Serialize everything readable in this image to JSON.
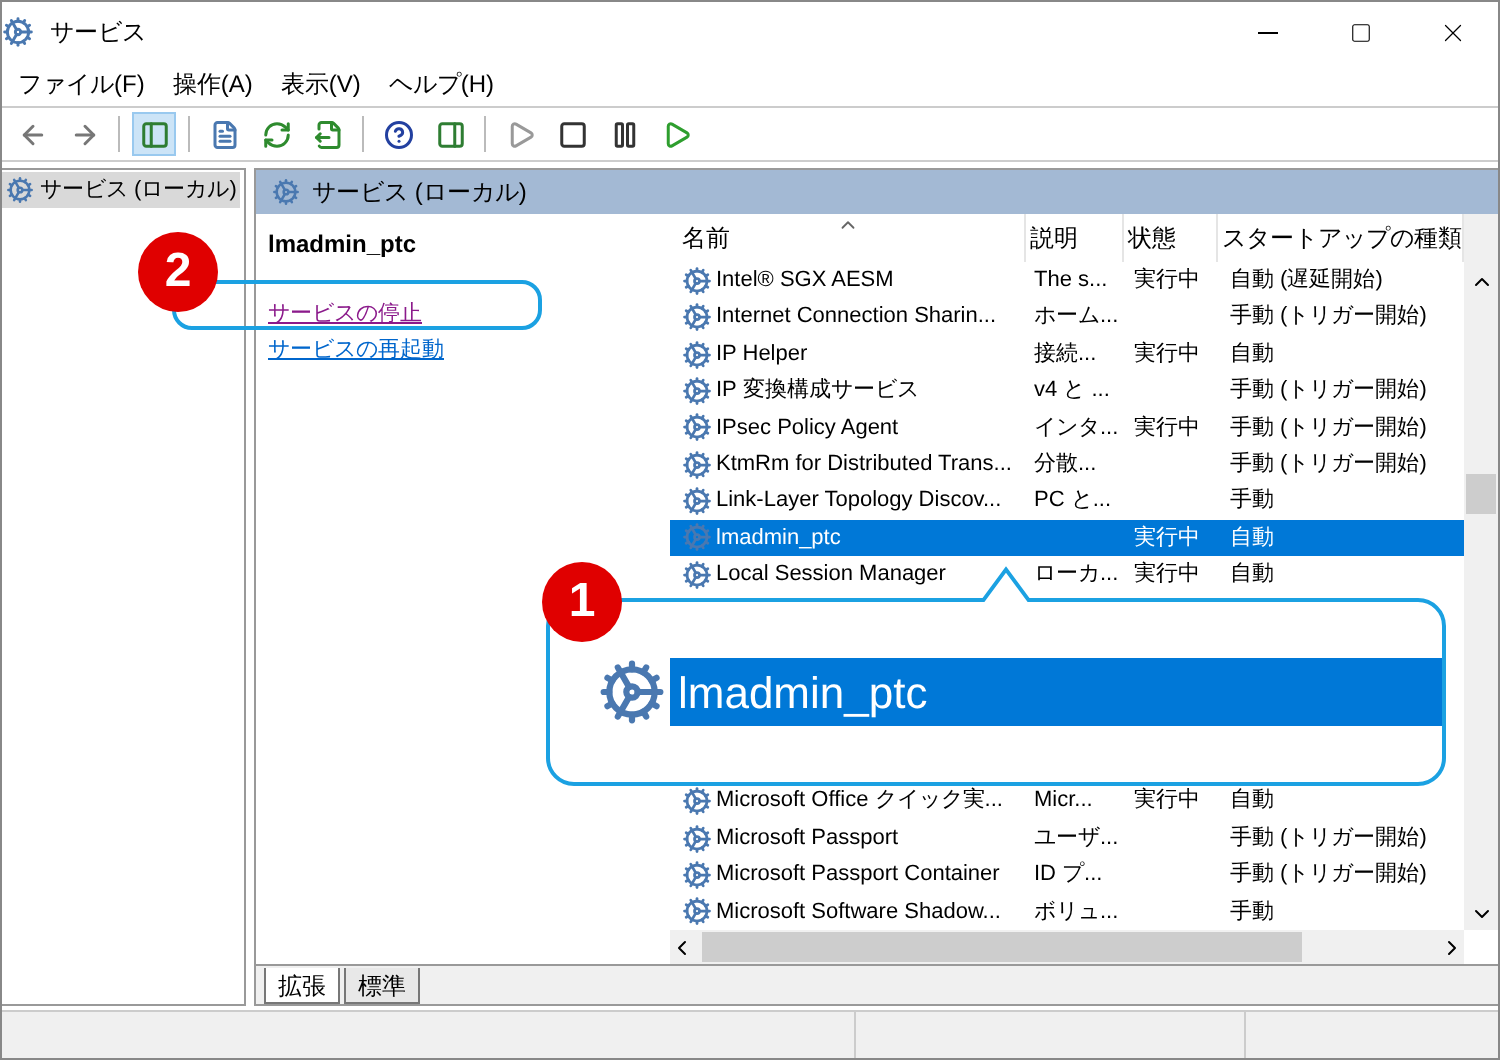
{
  "window": {
    "title": "サービス"
  },
  "menu": [
    {
      "label": "ファイル(F)"
    },
    {
      "label": "操作(A)"
    },
    {
      "label": "表示(V)"
    },
    {
      "label": "ヘルプ(H)"
    }
  ],
  "toolbar": [
    {
      "kind": "back",
      "pressed": false
    },
    {
      "kind": "forward",
      "pressed": false
    },
    {
      "kind": "sep"
    },
    {
      "kind": "tree",
      "pressed": true
    },
    {
      "kind": "sep"
    },
    {
      "kind": "props",
      "pressed": false
    },
    {
      "kind": "refresh",
      "pressed": false
    },
    {
      "kind": "export",
      "pressed": false
    },
    {
      "kind": "sep"
    },
    {
      "kind": "help",
      "pressed": false
    },
    {
      "kind": "panel",
      "pressed": false
    },
    {
      "kind": "sep"
    },
    {
      "kind": "start",
      "pressed": false
    },
    {
      "kind": "stop",
      "pressed": false
    },
    {
      "kind": "pause",
      "pressed": false
    },
    {
      "kind": "resume",
      "pressed": false
    }
  ],
  "tree": [
    {
      "label": "サービス (ローカル)",
      "selected": true
    }
  ],
  "pane": {
    "header": "サービス (ローカル)",
    "service_name": "lmadmin_ptc",
    "actions": [
      {
        "label": "サービスの停止",
        "visited": true
      },
      {
        "label": "サービスの再起動",
        "visited": false
      }
    ]
  },
  "table": {
    "columns": [
      {
        "label": "名前",
        "sorted": true
      },
      {
        "label": "説明",
        "sorted": false
      },
      {
        "label": "状態",
        "sorted": false
      },
      {
        "label": "スタートアップの種類",
        "sorted": false
      }
    ],
    "rows": [
      {
        "name": "Intel® SGX AESM",
        "description": "The s...",
        "status": "実行中",
        "startup": "自動 (遅延開始)",
        "selected": false
      },
      {
        "name": "Internet Connection Sharin...",
        "description": "ホーム...",
        "startup": "手動 (トリガー開始)",
        "selected": false
      },
      {
        "name": "IP Helper",
        "description": "接続...",
        "status": "実行中",
        "startup": "自動",
        "selected": false
      },
      {
        "name": "IP 変換構成サービス",
        "description": "v4 と ...",
        "startup": "手動 (トリガー開始)",
        "selected": false
      },
      {
        "name": "IPsec Policy Agent",
        "description": "インタ...",
        "status": "実行中",
        "startup": "手動 (トリガー開始)",
        "selected": false
      },
      {
        "name": "KtmRm for Distributed Trans...",
        "description": "分散...",
        "startup": "手動 (トリガー開始)",
        "selected": false
      },
      {
        "name": "Link-Layer Topology Discov...",
        "description": "PC と...",
        "startup": "手動",
        "selected": false
      },
      {
        "name": "lmadmin_ptc",
        "status": "実行中",
        "startup": "自動",
        "selected": true
      },
      {
        "name": "Local Session Manager",
        "description": "ローカ...",
        "status": "実行中",
        "startup": "自動",
        "selected": false
      }
    ],
    "rows_after_callout": [
      {
        "name": "Microsoft Office クイック実...",
        "description": "Micr...",
        "status": "実行中",
        "startup": "自動",
        "selected": false
      },
      {
        "name": "Microsoft Passport",
        "description": "ユーザ...",
        "startup": "手動 (トリガー開始)",
        "selected": false
      },
      {
        "name": "Microsoft Passport Container",
        "description": "ID プ...",
        "startup": "手動 (トリガー開始)",
        "selected": false
      },
      {
        "name": "Microsoft Software Shadow...",
        "description": "ボリュ...",
        "startup": "手動",
        "selected": false
      }
    ]
  },
  "tabs": [
    {
      "label": "拡張",
      "selected": true
    },
    {
      "label": "標準",
      "selected": false
    }
  ],
  "callouts": [
    {
      "number": "1",
      "text": "lmadmin_ptc"
    },
    {
      "number": "2"
    }
  ]
}
